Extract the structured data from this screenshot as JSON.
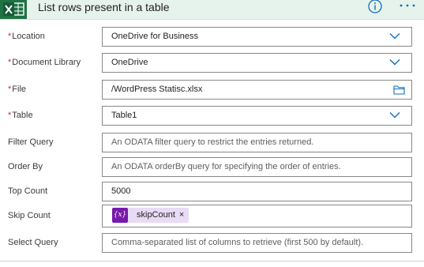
{
  "header": {
    "title": "List rows present in a table",
    "app_icon": "excel-icon",
    "info_icon": "info-icon",
    "more_icon": "more-options-icon",
    "accent": "#1f7244",
    "header_bg": "#e6f2ec"
  },
  "fields": {
    "location": {
      "label": "Location",
      "required": "*",
      "value": "OneDrive for Business",
      "icon": "chevron-down-icon"
    },
    "document_library": {
      "label": "Document Library",
      "required": "*",
      "value": "OneDrive",
      "icon": "chevron-down-icon"
    },
    "file": {
      "label": "File",
      "required": "*",
      "value": "/WordPress Statisc.xlsx",
      "icon": "folder-icon"
    },
    "table": {
      "label": "Table",
      "required": "*",
      "value": "Table1",
      "icon": "chevron-down-icon"
    },
    "filter_query": {
      "label": "Filter Query",
      "placeholder": "An ODATA filter query to restrict the entries returned."
    },
    "order_by": {
      "label": "Order By",
      "placeholder": "An ODATA orderBy query for specifying the order of entries."
    },
    "top_count": {
      "label": "Top Count",
      "value": "5000"
    },
    "skip_count": {
      "label": "Skip Count",
      "token": {
        "symbol": "{x}",
        "name": "skipCount",
        "remove": "×"
      }
    },
    "select_query": {
      "label": "Select Query",
      "placeholder": "Comma-separated list of columns to retrieve (first 500 by default)."
    }
  },
  "colors": {
    "required": "#c4314b",
    "token_bg": "#e8dbf5",
    "token_icon": "#7719aa",
    "chevron": "#0f6cbd"
  }
}
